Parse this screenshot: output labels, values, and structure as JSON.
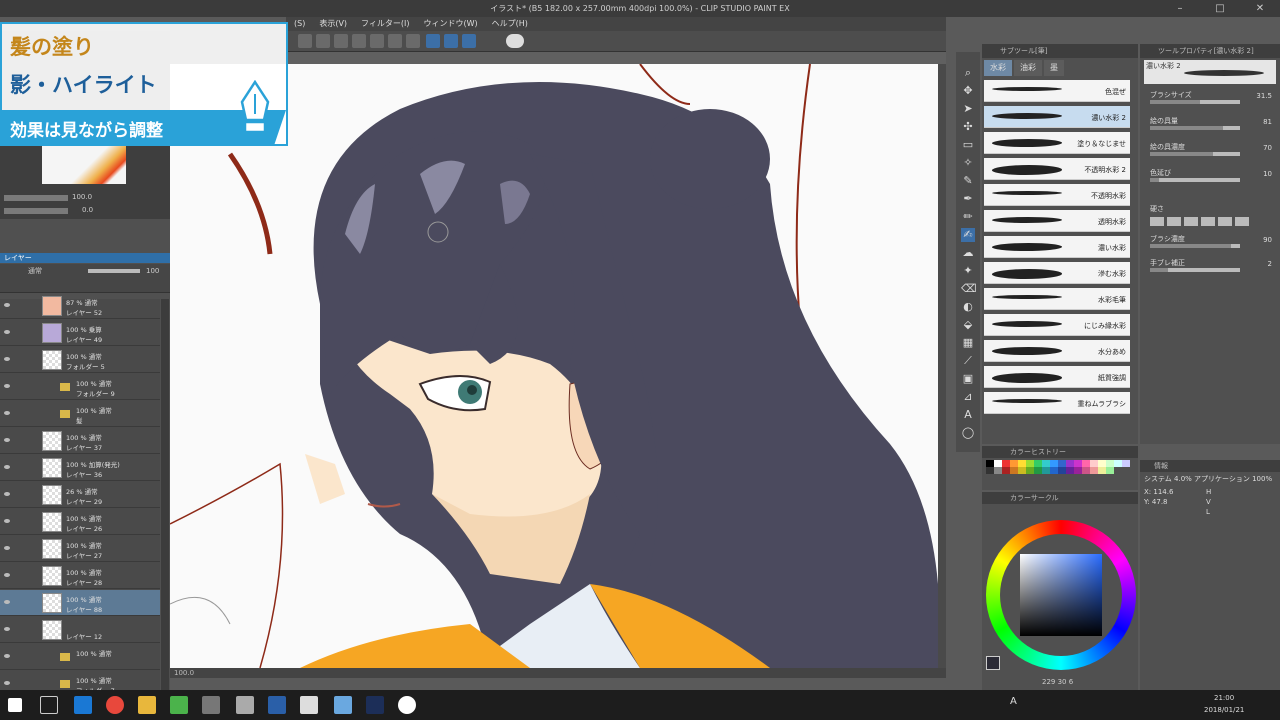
{
  "window": {
    "title": "イラスト* (B5 182.00 x 257.00mm 400dpi 100.0%) - CLIP STUDIO PAINT EX"
  },
  "menu": [
    "(S)",
    "表示(V)",
    "フィルター(I)",
    "ウィンドウ(W)",
    "ヘルプ(H)"
  ],
  "caption": {
    "line1": "髪の塗り",
    "line2": "影・ハイライト",
    "line3": "効果は見ながら調整"
  },
  "navigator": {
    "zoom_value": "100.0",
    "rotate_value": "0.0"
  },
  "layer_panel": {
    "tab": "レイヤー",
    "blend_mode": "通常",
    "opacity": "100",
    "layers": [
      {
        "pct": "87 % 通常",
        "name": "レイヤー 52",
        "thumb": "color"
      },
      {
        "pct": "100 % 乗算",
        "name": "レイヤー 49",
        "thumb": "color"
      },
      {
        "pct": "100 % 通常",
        "name": "フォルダー 5",
        "thumb": "check"
      },
      {
        "pct": "100 % 通常",
        "name": "フォルダー 9",
        "thumb": "folder"
      },
      {
        "pct": "100 % 通常",
        "name": "髪",
        "thumb": "folder"
      },
      {
        "pct": "100 % 通常",
        "name": "レイヤー 37",
        "thumb": "check"
      },
      {
        "pct": "100 % 加算(発光)",
        "name": "レイヤー 36",
        "thumb": "check"
      },
      {
        "pct": "26 % 通常",
        "name": "レイヤー 29",
        "thumb": "check"
      },
      {
        "pct": "100 % 通常",
        "name": "レイヤー 26",
        "thumb": "check"
      },
      {
        "pct": "100 % 通常",
        "name": "レイヤー 27",
        "thumb": "check"
      },
      {
        "pct": "100 % 通常",
        "name": "レイヤー 28",
        "thumb": "check"
      },
      {
        "pct": "100 % 通常",
        "name": "レイヤー 88",
        "thumb": "check",
        "selected": true
      },
      {
        "pct": "",
        "name": "レイヤー 12",
        "thumb": "check"
      },
      {
        "pct": "100 % 通常",
        "name": "",
        "thumb": "folder"
      },
      {
        "pct": "100 % 通常",
        "name": "フォルダー 7",
        "thumb": "folder"
      }
    ]
  },
  "canvas_status": {
    "zoom": "100.0"
  },
  "subtool": {
    "header": "サブツール[筆]",
    "tabs": [
      "水彩",
      "油彩",
      "墨"
    ],
    "brushes": [
      "色混ぜ",
      "濃い水彩 2",
      "塗り＆なじませ",
      "不透明水彩 2",
      "不透明水彩",
      "透明水彩",
      "濃い水彩",
      "滲む水彩",
      "水彩毛筆",
      "にじみ縁水彩",
      "水分あめ",
      "紙質強調",
      "重ねムラブラシ"
    ],
    "selected_index": 1
  },
  "tool_property": {
    "header": "ツールプロパティ[濃い水彩 2]",
    "preview_label": "濃い水彩 2",
    "props": [
      {
        "label": "ブラシサイズ",
        "value": "31.5",
        "level": 0.55
      },
      {
        "label": "絵の具量",
        "value": "81",
        "level": 0.81
      },
      {
        "label": "絵の具濃度",
        "value": "70",
        "level": 0.7
      },
      {
        "label": "色延び",
        "value": "10",
        "level": 0.1
      }
    ],
    "hardness_label": "硬さ",
    "density_label": "ブラシ濃度",
    "density_value": "90",
    "density_level": 0.9,
    "stab_label": "手ブレ補正",
    "stab_value": "2",
    "stab_level": 0.2
  },
  "color_history": {
    "header": "カラーヒストリー"
  },
  "color_wheel": {
    "header": "カラーサークル",
    "bottom_values": "229  30  6"
  },
  "info": {
    "header": "情報",
    "line1": "システム 4.0% アプリケーション 100%",
    "x": "X: 114.6",
    "y": "Y: 47.8",
    "h": "H",
    "v": "V",
    "l": "L"
  },
  "taskbar": {
    "time": "21:00",
    "date": "2018/01/21",
    "lang": "A"
  },
  "colors": {
    "accent": "#2aa2d8",
    "caption_gold": "#c4861b",
    "caption_blue": "#1e5f9a",
    "hair": "#4b4a5e",
    "skin": "#fbe6cc",
    "kimono": "#f6a623"
  }
}
